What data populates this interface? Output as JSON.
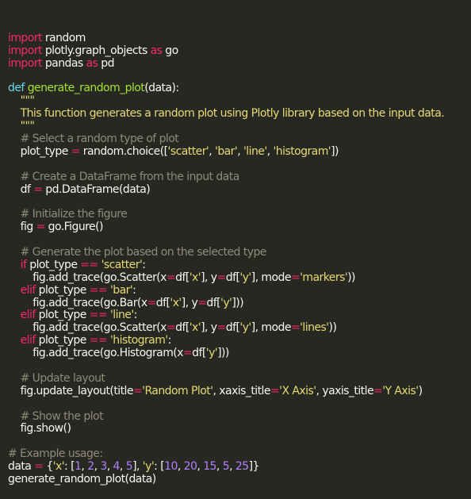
{
  "editor": {
    "language": "python",
    "theme_colors": {
      "background": "#272822",
      "plain": "#f8f8f2",
      "keyword": "#f92672",
      "def_keyword": "#66d9ef",
      "function_name": "#a6e22e",
      "string": "#e6db74",
      "comment": "#8f8b7a",
      "number": "#ae81ff"
    },
    "lines": [
      [
        {
          "t": "kw",
          "v": "import"
        },
        {
          "t": "plain",
          "v": " random"
        }
      ],
      [
        {
          "t": "kw",
          "v": "import"
        },
        {
          "t": "plain",
          "v": " plotly.graph_objects "
        },
        {
          "t": "kw",
          "v": "as"
        },
        {
          "t": "plain",
          "v": " go"
        }
      ],
      [
        {
          "t": "kw",
          "v": "import"
        },
        {
          "t": "plain",
          "v": " pandas "
        },
        {
          "t": "kw",
          "v": "as"
        },
        {
          "t": "plain",
          "v": " pd"
        }
      ],
      [],
      [
        {
          "t": "def",
          "v": "def"
        },
        {
          "t": "plain",
          "v": " "
        },
        {
          "t": "fn",
          "v": "generate_random_plot"
        },
        {
          "t": "plain",
          "v": "(data):"
        }
      ],
      [
        {
          "t": "str",
          "v": "    \"\"\""
        }
      ],
      [
        {
          "t": "str",
          "v": "    This function generates a random plot using Plotly library based on the input data."
        }
      ],
      [
        {
          "t": "str",
          "v": "    \"\"\""
        }
      ],
      [
        {
          "t": "comment",
          "v": "    # Select a random type of plot"
        }
      ],
      [
        {
          "t": "plain",
          "v": "    plot_type "
        },
        {
          "t": "kw",
          "v": "="
        },
        {
          "t": "plain",
          "v": " random.choice(["
        },
        {
          "t": "str",
          "v": "'scatter'"
        },
        {
          "t": "plain",
          "v": ", "
        },
        {
          "t": "str",
          "v": "'bar'"
        },
        {
          "t": "plain",
          "v": ", "
        },
        {
          "t": "str",
          "v": "'line'"
        },
        {
          "t": "plain",
          "v": ", "
        },
        {
          "t": "str",
          "v": "'histogram'"
        },
        {
          "t": "plain",
          "v": "])"
        }
      ],
      [],
      [
        {
          "t": "comment",
          "v": "    # Create a DataFrame from the input data"
        }
      ],
      [
        {
          "t": "plain",
          "v": "    df "
        },
        {
          "t": "kw",
          "v": "="
        },
        {
          "t": "plain",
          "v": " pd.DataFrame(data)"
        }
      ],
      [],
      [
        {
          "t": "comment",
          "v": "    # Initialize the figure"
        }
      ],
      [
        {
          "t": "plain",
          "v": "    fig "
        },
        {
          "t": "kw",
          "v": "="
        },
        {
          "t": "plain",
          "v": " go.Figure()"
        }
      ],
      [],
      [
        {
          "t": "comment",
          "v": "    # Generate the plot based on the selected type"
        }
      ],
      [
        {
          "t": "plain",
          "v": "    "
        },
        {
          "t": "kw",
          "v": "if"
        },
        {
          "t": "plain",
          "v": " plot_type "
        },
        {
          "t": "kw",
          "v": "=="
        },
        {
          "t": "plain",
          "v": " "
        },
        {
          "t": "str",
          "v": "'scatter'"
        },
        {
          "t": "plain",
          "v": ":"
        }
      ],
      [
        {
          "t": "plain",
          "v": "        fig.add_trace(go.Scatter(x"
        },
        {
          "t": "kw",
          "v": "="
        },
        {
          "t": "plain",
          "v": "df["
        },
        {
          "t": "str",
          "v": "'x'"
        },
        {
          "t": "plain",
          "v": "], y"
        },
        {
          "t": "kw",
          "v": "="
        },
        {
          "t": "plain",
          "v": "df["
        },
        {
          "t": "str",
          "v": "'y'"
        },
        {
          "t": "plain",
          "v": "], mode"
        },
        {
          "t": "kw",
          "v": "="
        },
        {
          "t": "str",
          "v": "'markers'"
        },
        {
          "t": "plain",
          "v": "))"
        }
      ],
      [
        {
          "t": "plain",
          "v": "    "
        },
        {
          "t": "kw",
          "v": "elif"
        },
        {
          "t": "plain",
          "v": " plot_type "
        },
        {
          "t": "kw",
          "v": "=="
        },
        {
          "t": "plain",
          "v": " "
        },
        {
          "t": "str",
          "v": "'bar'"
        },
        {
          "t": "plain",
          "v": ":"
        }
      ],
      [
        {
          "t": "plain",
          "v": "        fig.add_trace(go.Bar(x"
        },
        {
          "t": "kw",
          "v": "="
        },
        {
          "t": "plain",
          "v": "df["
        },
        {
          "t": "str",
          "v": "'x'"
        },
        {
          "t": "plain",
          "v": "], y"
        },
        {
          "t": "kw",
          "v": "="
        },
        {
          "t": "plain",
          "v": "df["
        },
        {
          "t": "str",
          "v": "'y'"
        },
        {
          "t": "plain",
          "v": "]))"
        }
      ],
      [
        {
          "t": "plain",
          "v": "    "
        },
        {
          "t": "kw",
          "v": "elif"
        },
        {
          "t": "plain",
          "v": " plot_type "
        },
        {
          "t": "kw",
          "v": "=="
        },
        {
          "t": "plain",
          "v": " "
        },
        {
          "t": "str",
          "v": "'line'"
        },
        {
          "t": "plain",
          "v": ":"
        }
      ],
      [
        {
          "t": "plain",
          "v": "        fig.add_trace(go.Scatter(x"
        },
        {
          "t": "kw",
          "v": "="
        },
        {
          "t": "plain",
          "v": "df["
        },
        {
          "t": "str",
          "v": "'x'"
        },
        {
          "t": "plain",
          "v": "], y"
        },
        {
          "t": "kw",
          "v": "="
        },
        {
          "t": "plain",
          "v": "df["
        },
        {
          "t": "str",
          "v": "'y'"
        },
        {
          "t": "plain",
          "v": "], mode"
        },
        {
          "t": "kw",
          "v": "="
        },
        {
          "t": "str",
          "v": "'lines'"
        },
        {
          "t": "plain",
          "v": "))"
        }
      ],
      [
        {
          "t": "plain",
          "v": "    "
        },
        {
          "t": "kw",
          "v": "elif"
        },
        {
          "t": "plain",
          "v": " plot_type "
        },
        {
          "t": "kw",
          "v": "=="
        },
        {
          "t": "plain",
          "v": " "
        },
        {
          "t": "str",
          "v": "'histogram'"
        },
        {
          "t": "plain",
          "v": ":"
        }
      ],
      [
        {
          "t": "plain",
          "v": "        fig.add_trace(go.Histogram(x"
        },
        {
          "t": "kw",
          "v": "="
        },
        {
          "t": "plain",
          "v": "df["
        },
        {
          "t": "str",
          "v": "'y'"
        },
        {
          "t": "plain",
          "v": "]))"
        }
      ],
      [],
      [
        {
          "t": "comment",
          "v": "    # Update layout"
        }
      ],
      [
        {
          "t": "plain",
          "v": "    fig.update_layout(title"
        },
        {
          "t": "kw",
          "v": "="
        },
        {
          "t": "str",
          "v": "'Random Plot'"
        },
        {
          "t": "plain",
          "v": ", xaxis_title"
        },
        {
          "t": "kw",
          "v": "="
        },
        {
          "t": "str",
          "v": "'X Axis'"
        },
        {
          "t": "plain",
          "v": ", yaxis_title"
        },
        {
          "t": "kw",
          "v": "="
        },
        {
          "t": "str",
          "v": "'Y Axis'"
        },
        {
          "t": "plain",
          "v": ")"
        }
      ],
      [],
      [
        {
          "t": "comment",
          "v": "    # Show the plot"
        }
      ],
      [
        {
          "t": "plain",
          "v": "    fig.show()"
        }
      ],
      [],
      [
        {
          "t": "comment",
          "v": "# Example usage:"
        }
      ],
      [
        {
          "t": "plain",
          "v": "data "
        },
        {
          "t": "kw",
          "v": "="
        },
        {
          "t": "plain",
          "v": " {"
        },
        {
          "t": "str",
          "v": "'x'"
        },
        {
          "t": "plain",
          "v": ": ["
        },
        {
          "t": "num",
          "v": "1"
        },
        {
          "t": "plain",
          "v": ", "
        },
        {
          "t": "num",
          "v": "2"
        },
        {
          "t": "plain",
          "v": ", "
        },
        {
          "t": "num",
          "v": "3"
        },
        {
          "t": "plain",
          "v": ", "
        },
        {
          "t": "num",
          "v": "4"
        },
        {
          "t": "plain",
          "v": ", "
        },
        {
          "t": "num",
          "v": "5"
        },
        {
          "t": "plain",
          "v": "], "
        },
        {
          "t": "str",
          "v": "'y'"
        },
        {
          "t": "plain",
          "v": ": ["
        },
        {
          "t": "num",
          "v": "10"
        },
        {
          "t": "plain",
          "v": ", "
        },
        {
          "t": "num",
          "v": "20"
        },
        {
          "t": "plain",
          "v": ", "
        },
        {
          "t": "num",
          "v": "15"
        },
        {
          "t": "plain",
          "v": ", "
        },
        {
          "t": "num",
          "v": "5"
        },
        {
          "t": "plain",
          "v": ", "
        },
        {
          "t": "num",
          "v": "25"
        },
        {
          "t": "plain",
          "v": "]}"
        }
      ],
      [
        {
          "t": "plain",
          "v": "generate_random_plot(data)"
        }
      ]
    ]
  }
}
